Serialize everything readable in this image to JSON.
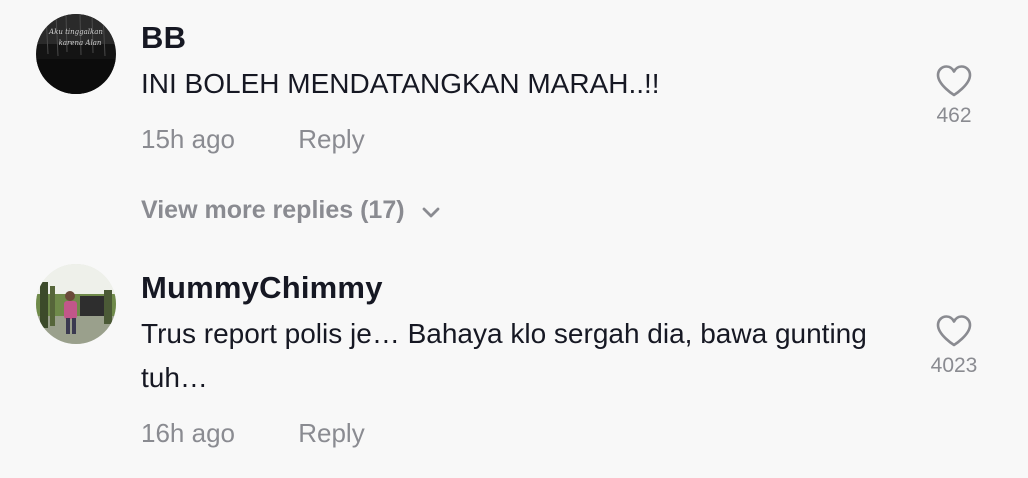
{
  "comments": [
    {
      "username": "BB",
      "text": "INI BOLEH MENDATANGKAN MARAH..!!",
      "time": "15h ago",
      "reply_label": "Reply",
      "likes": "462",
      "avatar_text_line1": "Aku tinggalkan",
      "avatar_text_line2": "karena Alan"
    },
    {
      "username": "MummyChimmy",
      "text": "Trus report polis je… Bahaya klo sergah dia, bawa gunting tuh…",
      "time": "16h ago",
      "reply_label": "Reply",
      "likes": "4023"
    }
  ],
  "view_more": {
    "label": "View more replies (17)",
    "icon": "chevron-down-icon"
  },
  "icons": {
    "like": "heart-outline-icon"
  },
  "colors": {
    "background": "#f8f8f8",
    "primary_text": "#161823",
    "secondary_text": "#8a8b91"
  }
}
